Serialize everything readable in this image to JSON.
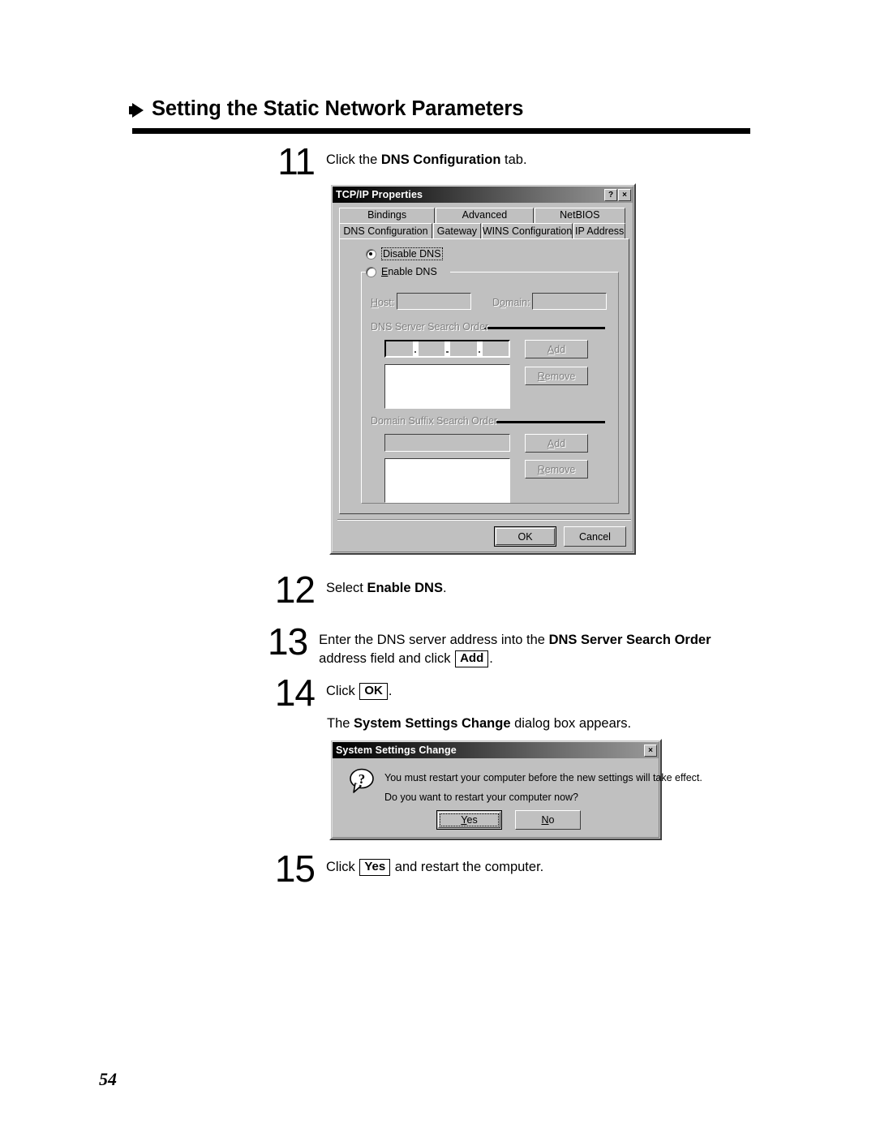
{
  "page": {
    "header_title": "Setting the Static Network Parameters",
    "page_number": "54"
  },
  "steps": [
    {
      "number": "11",
      "text_before": "Click the ",
      "bold": "DNS Configuration",
      "text_after": " tab."
    },
    {
      "number": "12",
      "text_before": "Select ",
      "bold": "Enable DNS",
      "text_after": "."
    },
    {
      "number": "13",
      "line1_before": "Enter the DNS server address into the ",
      "line1_bold": "DNS Server Search",
      "line2_bold": "Order",
      "line2_mid": " address field and click ",
      "line2_key": "Add",
      "line2_after": "."
    },
    {
      "number": "14",
      "text_before": "Click ",
      "key": "OK",
      "text_after": "."
    },
    {
      "number": "15",
      "text_before": "Click ",
      "key": "Yes",
      "text_after": " and restart the computer."
    }
  ],
  "note": {
    "before": "The ",
    "bold": "System Settings Change",
    "after": " dialog box appears."
  },
  "tcpip_dialog": {
    "title": "TCP/IP Properties",
    "help_button": "?",
    "close_button": "×",
    "tabs_row1": [
      "Bindings",
      "Advanced",
      "NetBIOS"
    ],
    "tabs_row2": [
      "DNS Configuration",
      "Gateway",
      "WINS Configuration",
      "IP Address"
    ],
    "selected_tab": "DNS Configuration",
    "radio_disable": "Disable DNS",
    "radio_enable": "Enable DNS",
    "radio_selected": "Disable DNS",
    "host_label": "Host:",
    "host_value": "",
    "domain_label": "Domain:",
    "domain_value": "",
    "dns_group_label": "DNS Server Search Order",
    "dns_add_button": "Add",
    "dns_remove_button": "Remove",
    "suffix_group_label": "Domain Suffix Search Order",
    "suffix_field_value": "",
    "suffix_add_button": "Add",
    "suffix_remove_button": "Remove",
    "ok_button": "OK",
    "cancel_button": "Cancel"
  },
  "settings_dialog": {
    "title": "System Settings Change",
    "close_button": "×",
    "icon": "question-mark-icon",
    "line1": "You must restart your computer before the new settings will take effect.",
    "line2": "Do you want to restart your computer now?",
    "yes_button": "Yes",
    "no_button": "No"
  },
  "colors": {
    "dialog_face": "#c0c0c0",
    "titlebar_dark": "#000000",
    "text": "#000000",
    "disabled_text": "#808080"
  }
}
